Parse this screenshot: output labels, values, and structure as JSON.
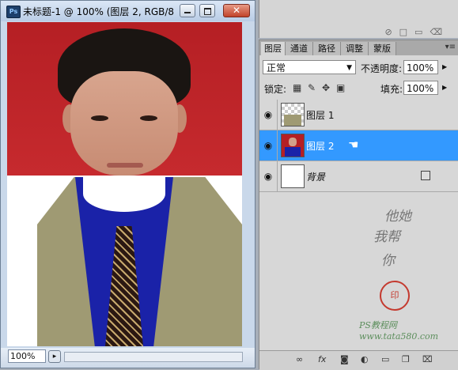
{
  "document": {
    "title": "未标题-1 @ 100% (图层 2, RGB/8...",
    "app_badge": "Ps",
    "zoom": "100%",
    "close_label": "✕"
  },
  "tabs": [
    "图层",
    "通道",
    "路径",
    "调整",
    "蒙版"
  ],
  "active_tab": "图层",
  "blend_mode": "正常",
  "opacity_label": "不透明度:",
  "opacity_value": "100%",
  "lock_label": "锁定:",
  "fill_label": "填充:",
  "fill_value": "100%",
  "layers": [
    {
      "name": "图层 1",
      "visible": true,
      "thumbnail": "transparent-jacket"
    },
    {
      "name": "图层 2",
      "visible": true,
      "selected": true,
      "thumbnail": "portrait-photo"
    },
    {
      "name": "背景",
      "visible": true,
      "locked": true,
      "thumbnail": "white"
    }
  ],
  "watermark": {
    "line1": "他她",
    "line2": "我帮",
    "line3": "你",
    "seal": "印",
    "site": "PS教程网",
    "url": "www.tata580.com"
  },
  "icons": {
    "eye": "eye-icon",
    "lock": "lock-icon",
    "link": "link-icon",
    "fx": "fx-icon",
    "mask": "mask-icon",
    "adjust": "adjustment-icon",
    "group": "folder-icon",
    "new": "new-layer-icon",
    "trash": "trash-icon"
  },
  "colors": {
    "selection": "#3399ff",
    "panel_bg": "#d7d7d7",
    "backdrop_red": "#b51f24",
    "shirt_blue": "#1a22a8"
  }
}
